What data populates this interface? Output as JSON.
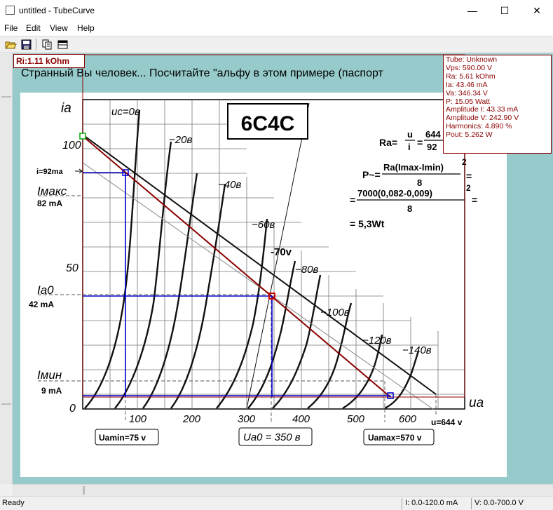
{
  "window": {
    "title": "untitled - TubeCurve",
    "minimize": "—",
    "maximize": "☐",
    "close": "✕"
  },
  "menu": [
    "File",
    "Edit",
    "View",
    "Help"
  ],
  "toolbar": {
    "buttons": [
      "open-icon",
      "save-icon",
      "copy-icon",
      "window-icon"
    ]
  },
  "overlay": {
    "ri_label": "Ri:1.11 kOhm",
    "russian_text": "Странный Вы человек... Посчитайте \"альфу в этом примере (паспорт",
    "info": [
      "Tube: Unknown",
      "Vps: 590.00 V",
      "Ra: 5.61 kOhm",
      "Ia: 43.46 mA",
      "Va: 346.34 V",
      "P: 15.05 Watt",
      "Amplitude I: 43.33 mA",
      "Amplitude V: 242.90 V",
      "Harmonics: 4.890 %",
      "Pout: 5.262 W"
    ]
  },
  "scan": {
    "tube": "6С4С",
    "y_axis_label": "iа",
    "x_axis_label": "uа",
    "y_ticks": [
      "100",
      "50",
      "0"
    ],
    "x_ticks": [
      "100",
      "200",
      "300",
      "400",
      "500",
      "600"
    ],
    "grid_labels": [
      "uс=0в",
      "−20в",
      "−40в",
      "−60в",
      "-70v",
      "−80в",
      "−100в",
      "−120в",
      "−140в"
    ],
    "left_labels": {
      "i92": "i=92ma",
      "imax": "Iмакс",
      "imax_val": "82 mA",
      "ia0": "Iа0",
      "ia0_val": "42 mA",
      "imin": "Iмин",
      "imin_val": "9 mA"
    },
    "bottom_labels": {
      "uamin": "Uamin=75 v",
      "ua0": "Uа0 = 350 в",
      "uamax": "Uamax=570 v",
      "u644": "u=644 v"
    },
    "formulas": {
      "ra_lhs": "Ra=",
      "ra_frac1_num": "u",
      "ra_frac1_den": "i",
      "ra_eq": "=",
      "ra_frac2_num": "644",
      "ra_frac2_den": "92",
      "p_lhs": "P~=",
      "p1_num": "Ra(Imax-Imin)",
      "p1_den": "8",
      "p1_exp": "2",
      "p2_num": "7000(0,082-0,009)",
      "p2_den": "8",
      "p2_exp": "2",
      "eq_sign": "=",
      "result": "= 5,3Wt"
    }
  },
  "status": {
    "left": "Ready",
    "current": "I: 0.0-120.0 mA",
    "voltage": "V: 0.0-700.0 V"
  }
}
